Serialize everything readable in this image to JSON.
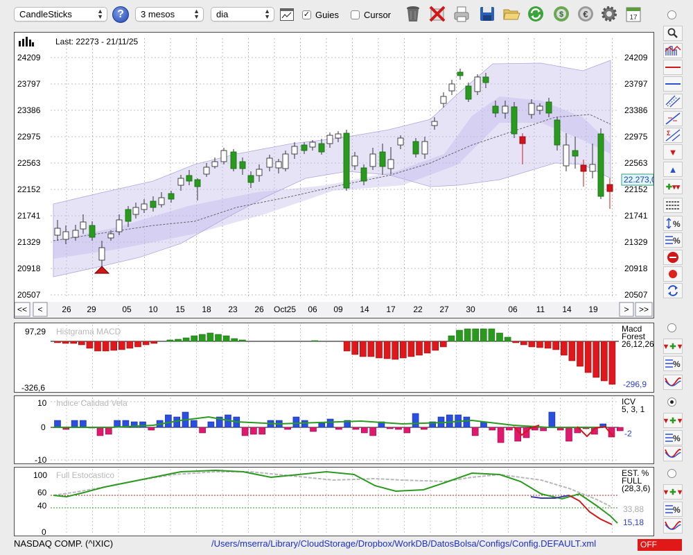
{
  "toolbar": {
    "chart_type": "CandleSticks",
    "help_label": "?",
    "period": "3 mesos",
    "interval": "dia",
    "guides_label": "Guies",
    "guides_checked": true,
    "cursor_label": "Cursor",
    "cursor_checked": false,
    "icons": [
      "chart-window-icon",
      "trash-icon",
      "delete-x-icon",
      "print-icon",
      "save-icon",
      "open-folder-icon",
      "refresh-icon",
      "reload-dollar-icon",
      "euro-icon",
      "gear-icon",
      "calendar-icon"
    ],
    "calendar_day": "17"
  },
  "main_chart": {
    "last_label": "Last: 22273 - 21/11/25",
    "y_ticks": [
      "24209",
      "23797",
      "23386",
      "22975",
      "22563",
      "22152",
      "21741",
      "21329",
      "20918",
      "20507"
    ],
    "current_price": "22.273,0",
    "x_labels": [
      "26",
      "29",
      "05",
      "10",
      "15",
      "18",
      "23",
      "26",
      "Oct25",
      "06",
      "09",
      "14",
      "17",
      "22",
      "27",
      "30",
      "06",
      "11",
      "14",
      "19"
    ],
    "nav_first": "<<",
    "nav_prev": "<",
    "nav_next": ">",
    "nav_last": ">>",
    "colors": {
      "up": "#2a9a1f",
      "down": "#d4141c",
      "band": "#c8c0ee",
      "hollow": "#ffffff"
    }
  },
  "macd_panel": {
    "title": "Histgrama MACD",
    "y_top": "97,29",
    "y_bottom": "-326,6",
    "side_name_1": "Macd",
    "side_name_2": "Forest",
    "side_params": "26,12,26",
    "side_value": "-296,9"
  },
  "icv_panel": {
    "title": "Indice Calidad Vela",
    "y_top": "10",
    "y_mid": "0",
    "y_bottom": "-10",
    "side_name": "ICV",
    "side_params": "5, 3, 1",
    "side_value": "-2"
  },
  "stoch_panel": {
    "title": "Full Estocastico",
    "y_ticks": [
      "100",
      "60",
      "40",
      "0"
    ],
    "side_name_1": "EST. %",
    "side_name_2": "FULL",
    "side_params": "(28,3,6)",
    "value_slow": "33,88",
    "value_fast": "15,18"
  },
  "right_tools": [
    "zoom-icon",
    "indicator-icon",
    "horizontal-red-line-icon",
    "horizontal-blue-line-icon",
    "channel-icon",
    "trendline-icon",
    "fibonacci-icon",
    "sell-arrow-icon",
    "buy-arrow-icon",
    "add-indicator-icon",
    "grid-lines-icon",
    "percent-scale-icon",
    "percent-lines-icon",
    "stop-icon",
    "record-icon",
    "swap-icon"
  ],
  "status": {
    "symbol": "NASDAQ COMP. (^IXIC)",
    "path": "/Users/mserra/Library/CloudStorage/Dropbox/WorkDB/DatosBolsa/Configs/Config.DEFAULT.xml",
    "state": "OFF"
  }
}
